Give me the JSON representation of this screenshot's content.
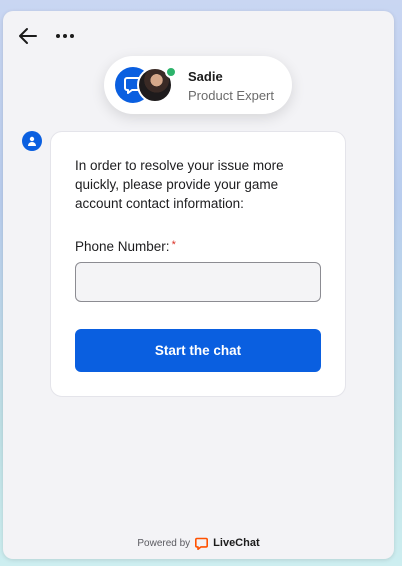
{
  "header": {
    "back_icon": "arrow-left-icon",
    "more_icon": "more-horizontal-icon"
  },
  "agent": {
    "name": "Sadie",
    "role": "Product Expert",
    "status": "online",
    "status_color": "#2db36b",
    "brand_icon": "chat-bubble-icon",
    "brand_color": "#0a5fe0"
  },
  "form": {
    "intro": "In order to resolve your issue more quickly, please provide your game account contact information:",
    "phone_label": "Phone Number:",
    "required_marker": "*",
    "phone_value": "",
    "phone_placeholder": "",
    "submit_label": "Start the chat"
  },
  "footer": {
    "powered_by": "Powered by",
    "brand": "LiveChat",
    "brand_icon": "livechat-logo-icon",
    "brand_color": "#ff5100"
  },
  "colors": {
    "accent": "#0a5fe0"
  }
}
